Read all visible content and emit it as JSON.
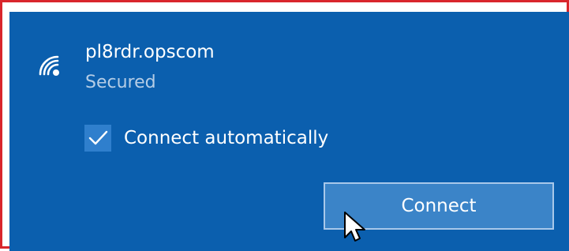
{
  "network": {
    "name": "pl8rdr.opscom",
    "status": "Secured",
    "icon": "wifi-secured-icon"
  },
  "auto_connect": {
    "label": "Connect automatically",
    "checked": true
  },
  "actions": {
    "connect_label": "Connect"
  },
  "colors": {
    "panel_bg": "#0b5fae",
    "frame_border": "#d9262c",
    "checkbox_bg": "#2f7fcd",
    "button_bg": "#3b84c8",
    "secondary_text": "#b5cde6"
  }
}
